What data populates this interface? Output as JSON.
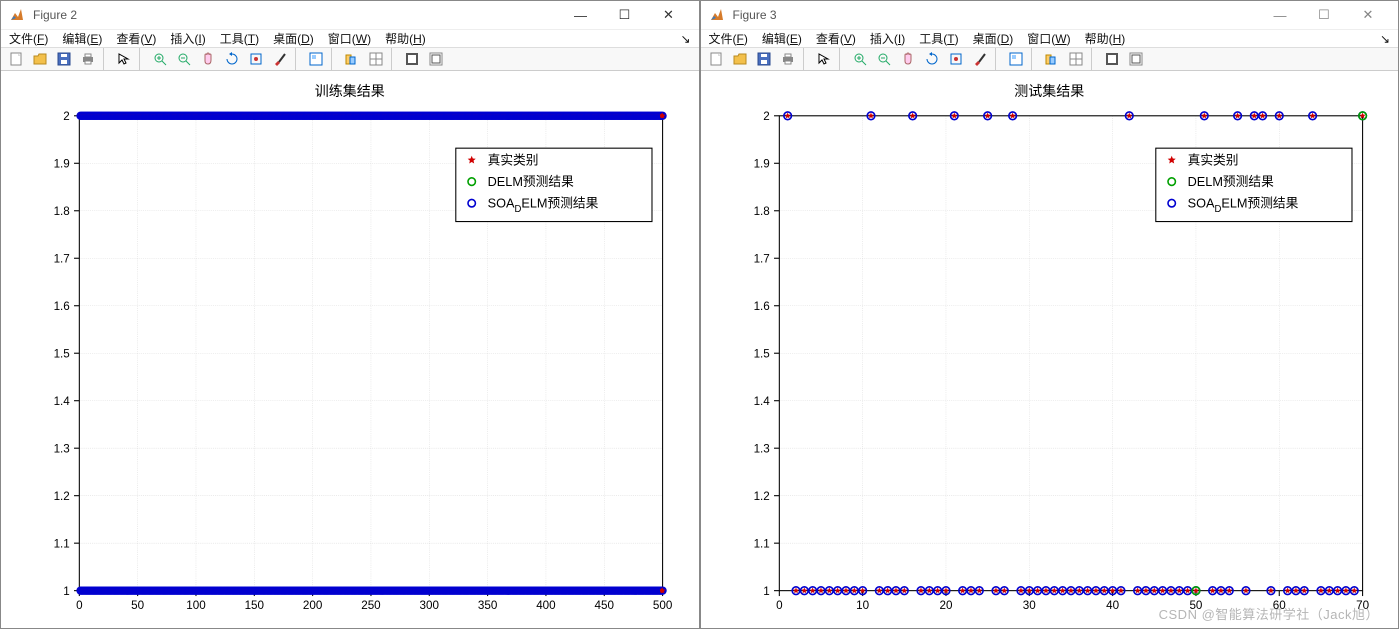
{
  "windows": [
    {
      "title": "Figure 2",
      "charttitle": "训练集结果"
    },
    {
      "title": "Figure 3",
      "charttitle": "测试集结果"
    }
  ],
  "menus": [
    "文件(F)",
    "编辑(E)",
    "查看(V)",
    "插入(I)",
    "工具(T)",
    "桌面(D)",
    "窗口(W)",
    "帮助(H)"
  ],
  "winctrls": {
    "min": "—",
    "max": "☐",
    "close": "✕"
  },
  "toolbar_icons": [
    "new",
    "open",
    "save",
    "print",
    "sep",
    "arrow",
    "sep",
    "zoomin",
    "zoomout",
    "hand",
    "rotate",
    "cursor",
    "brush",
    "sep",
    "insert",
    "sep",
    "copy",
    "layout",
    "sep",
    "link",
    "play"
  ],
  "legend": {
    "items": [
      {
        "label": "真实类别",
        "marker": "star-red"
      },
      {
        "label": "DELM预测结果",
        "marker": "circle-green"
      },
      {
        "label": "SOA_DELM预测结果",
        "marker": "circle-blue",
        "sublabel": "SOA",
        "subD": "D",
        "rest": "ELM预测结果"
      }
    ]
  },
  "watermark": "CSDN @智能算法研学社（Jack旭）",
  "chart_data": [
    {
      "type": "scatter",
      "title": "训练集结果",
      "xlabel": "",
      "ylabel": "",
      "xlim": [
        0,
        500
      ],
      "ylim": [
        1,
        2
      ],
      "xticks": [
        0,
        50,
        100,
        150,
        200,
        250,
        300,
        350,
        400,
        450,
        500
      ],
      "yticks": [
        1,
        1.1,
        1.2,
        1.3,
        1.4,
        1.5,
        1.6,
        1.7,
        1.8,
        1.9,
        2
      ],
      "series": [
        {
          "name": "真实类别",
          "marker": "star-red",
          "y_values_note": "binary 1 or 2 for each x=1..500, dense along both y=1 and y=2"
        },
        {
          "name": "DELM预测结果",
          "marker": "circle-green",
          "y_values_note": "overlaid, mostly matching"
        },
        {
          "name": "SOA_DELM预测结果",
          "marker": "circle-blue",
          "y_values_note": "overlaid, mostly matching"
        }
      ],
      "approx_points": {
        "y2_x": "dense 1..500",
        "y1_x": "dense 1..500"
      }
    },
    {
      "type": "scatter",
      "title": "测试集结果",
      "xlabel": "",
      "ylabel": "",
      "xlim": [
        0,
        70
      ],
      "ylim": [
        1,
        2
      ],
      "xticks": [
        0,
        10,
        20,
        30,
        40,
        50,
        60,
        70
      ],
      "yticks": [
        1,
        1.1,
        1.2,
        1.3,
        1.4,
        1.5,
        1.6,
        1.7,
        1.8,
        1.9,
        2
      ],
      "series": [
        {
          "name": "真实类别",
          "marker": "star-red"
        },
        {
          "name": "DELM预测结果",
          "marker": "circle-green"
        },
        {
          "name": "SOA_DELM预测结果",
          "marker": "circle-blue"
        }
      ],
      "points_y2_x": [
        1,
        11,
        16,
        21,
        25,
        28,
        42,
        51,
        55,
        57,
        58,
        60,
        64,
        70
      ],
      "points_y1_x": [
        2,
        3,
        4,
        5,
        6,
        7,
        8,
        9,
        10,
        12,
        13,
        14,
        15,
        17,
        18,
        19,
        20,
        22,
        23,
        24,
        26,
        27,
        29,
        30,
        31,
        32,
        33,
        34,
        35,
        36,
        37,
        38,
        39,
        40,
        41,
        43,
        44,
        45,
        46,
        47,
        48,
        49,
        50,
        52,
        53,
        54,
        56,
        59,
        61,
        62,
        63,
        65,
        66,
        67,
        68,
        69
      ],
      "green_mismatch_x": [
        50,
        70
      ]
    }
  ]
}
